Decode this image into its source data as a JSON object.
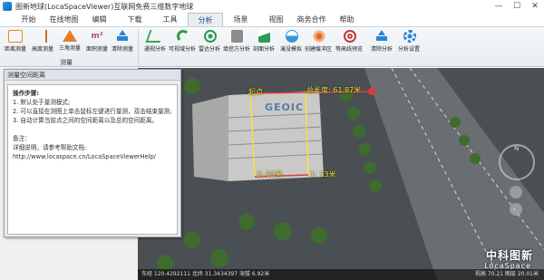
{
  "window": {
    "title": "图新地球(LocaSpaceViewer)互联网免费三维数字地球",
    "min": "—",
    "max": "☐",
    "close": "✕"
  },
  "tabs": [
    "开始",
    "在线地图",
    "编辑",
    "下载",
    "工具",
    "分析",
    "场景",
    "视图",
    "商务合作",
    "帮助"
  ],
  "active_tab": "分析",
  "ribbon": {
    "measure_group": "测量",
    "tools": [
      {
        "label": "距离测量",
        "icon": "distance-ruler-icon",
        "color": "#e08a2a"
      },
      {
        "label": "高度测量",
        "icon": "height-measure-icon",
        "color": "#d46b1e"
      },
      {
        "label": "三角测量",
        "icon": "triangle-measure-icon",
        "color": "#e37f2a"
      },
      {
        "label": "面积测量",
        "icon": "area-measure-icon",
        "color": "#b34f6a"
      },
      {
        "label": "清除测量",
        "icon": "clear-measure-icon",
        "color": "#2a84d6"
      },
      {
        "label": "通视分析",
        "icon": "line-of-sight-icon",
        "color": "#3aa64a"
      },
      {
        "label": "可视域分析",
        "icon": "viewshed-icon",
        "color": "#2f9e44"
      },
      {
        "label": "雷达分析",
        "icon": "radar-icon",
        "color": "#2b9a4e"
      },
      {
        "label": "填挖方分析",
        "icon": "cut-fill-icon",
        "color": "#8b8b8b"
      },
      {
        "label": "剖面分析",
        "icon": "profile-icon",
        "color": "#2c9a58"
      },
      {
        "label": "淹没模拟",
        "icon": "flood-icon",
        "color": "#3b95d9"
      },
      {
        "label": "创建缓冲区",
        "icon": "buffer-icon",
        "color": "#e26b2a"
      },
      {
        "label": "等高线预览",
        "icon": "contour-icon",
        "color": "#c23a3a"
      },
      {
        "label": "清除分析",
        "icon": "clear-analysis-icon",
        "color": "#2a84d6"
      },
      {
        "label": "分析设置",
        "icon": "settings-gear-icon",
        "color": "#2a84d6"
      }
    ]
  },
  "dialog": {
    "title": "测量空间距离",
    "lines": [
      "操作步骤:",
      "1. 默认处于量测模式;",
      "2. 可以直接在测图上单击鼠标左键进行量测，双击结束量测;",
      "3. 自动计算当前点之间的空间距离以及总的空间距离。",
      "",
      "备注：",
      "详细说明，请参考帮助文档:",
      "http://www.locaspace.cn/LocaSpaceViewerHelp/"
    ]
  },
  "viewport": {
    "label_start": "起点",
    "label_total": "总长度: 61.87米",
    "label_seg1": "2: 03米",
    "label_seg2": "1: 13米",
    "building_sign": "GEOIC",
    "status": "东经 120.4292111  北纬 31.3434397  海拔 6.92米",
    "status_right": "视高 70.21  图层 20.01米",
    "brand_cn": "中科图新",
    "brand_en": "LocaSpace",
    "compass_n": "N"
  }
}
